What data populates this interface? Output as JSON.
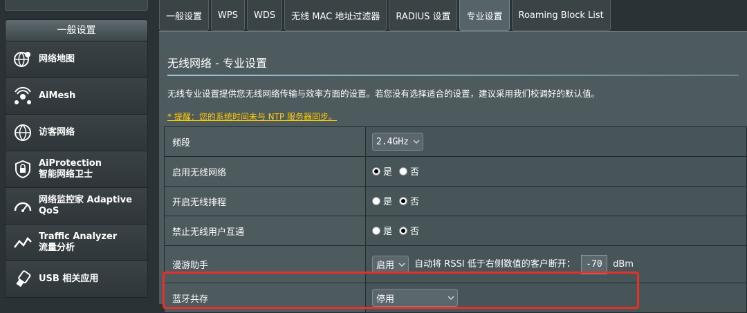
{
  "sidebar": {
    "header": "一般设置",
    "items": [
      {
        "icon": "network-map-icon",
        "label": "网络地图"
      },
      {
        "icon": "aimesh-icon",
        "label": "AiMesh"
      },
      {
        "icon": "guest-network-icon",
        "label": "访客网络"
      },
      {
        "icon": "aiprotection-icon",
        "label": "AiProtection\n智能网络卫士"
      },
      {
        "icon": "adaptive-qos-icon",
        "label": "网络监控家 Adaptive\nQoS"
      },
      {
        "icon": "traffic-analyzer-icon",
        "label": "Traffic Analyzer\n流量分析"
      },
      {
        "icon": "usb-icon",
        "label": "USB 相关应用"
      }
    ]
  },
  "tabs": [
    {
      "label": "一般设置",
      "active": false
    },
    {
      "label": "WPS",
      "active": false
    },
    {
      "label": "WDS",
      "active": false
    },
    {
      "label": "无线 MAC 地址过滤器",
      "active": false
    },
    {
      "label": "RADIUS 设置",
      "active": false
    },
    {
      "label": "专业设置",
      "active": true
    },
    {
      "label": "Roaming Block List",
      "active": false
    }
  ],
  "page": {
    "title": "无线网络 - 专业设置",
    "description": "无线专业设置提供您无线网络传输与效率方面的设置。若您没有选择适合的设置，建议采用我们校调好的默认值。",
    "warning": "* 提醒：您的系统时间未与 NTP 服务器同步。"
  },
  "settings": {
    "band": {
      "label": "频段",
      "value": "2.4GHz"
    },
    "enable_wireless": {
      "label": "启用无线网络",
      "yes": "是",
      "no": "否",
      "selected": "yes"
    },
    "wireless_schedule": {
      "label": "开启无线排程",
      "yes": "是",
      "no": "否",
      "selected": "no"
    },
    "ap_isolation": {
      "label": "禁止无线用户互通",
      "yes": "是",
      "no": "否",
      "selected": "no"
    },
    "roaming_assistant": {
      "label": "漫游助手",
      "value": "启用",
      "text": "自动将 RSSI 低于右侧数值的客户断开：",
      "rssi": "-70",
      "unit": "dBm"
    },
    "bluetooth_coexistence": {
      "label": "蓝牙共存",
      "value": "停用"
    }
  },
  "colors": {
    "highlight": "#e8302a",
    "warning": "#ffcc00",
    "accent_rule": "#9ec5d3"
  }
}
